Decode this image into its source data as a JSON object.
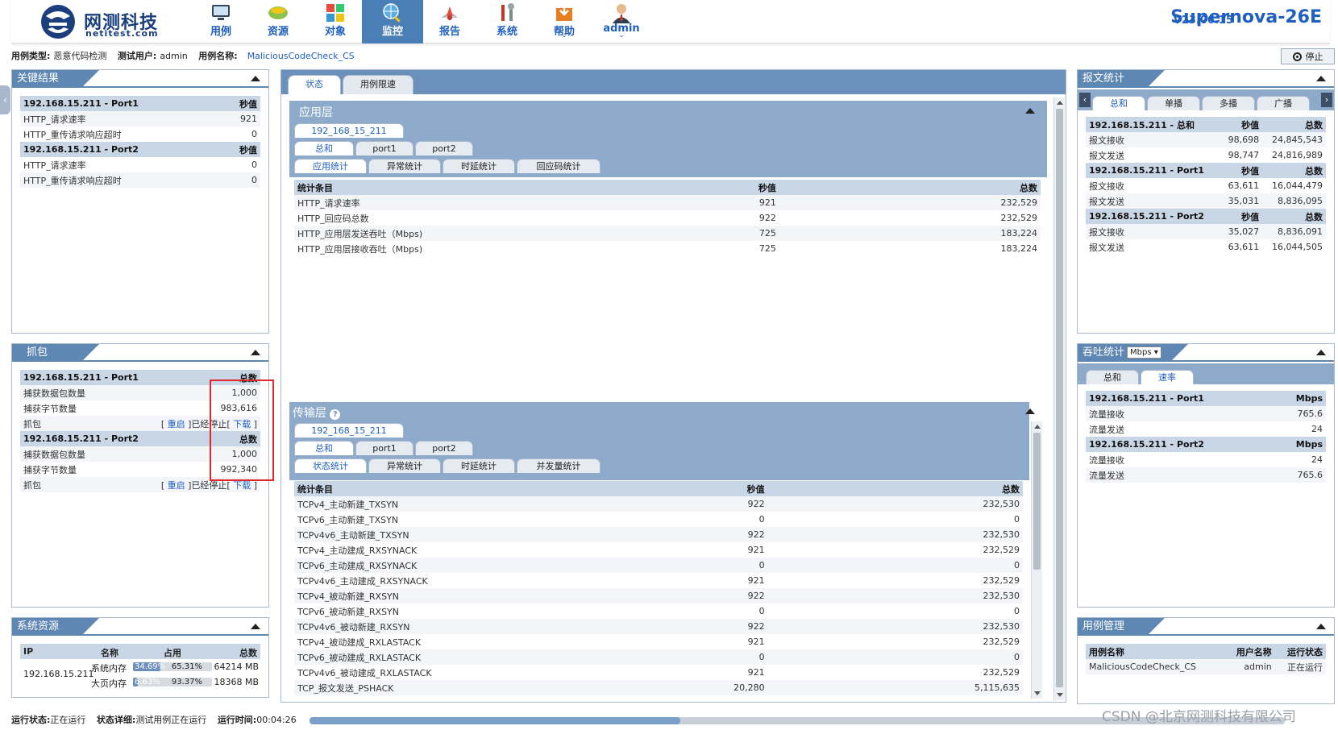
{
  "header": {
    "logo_cn": "网测科技",
    "logo_en": "netitest.com",
    "version": "V23.06.15",
    "product": "Supernova-26E",
    "nav": [
      {
        "label": "用例",
        "chevron": "⌄"
      },
      {
        "label": "资源",
        "chevron": ""
      },
      {
        "label": "对象",
        "chevron": ""
      },
      {
        "label": "监控",
        "chevron": ""
      },
      {
        "label": "报告",
        "chevron": ""
      },
      {
        "label": "系统",
        "chevron": ""
      },
      {
        "label": "帮助",
        "chevron": "⌄"
      },
      {
        "label": "admin",
        "chevron": "⌄"
      }
    ]
  },
  "info": {
    "type_k": "用例类型:",
    "type_v": "恶意代码检测",
    "user_k": "测试用户:",
    "user_v": "admin",
    "name_k": "用例名称:",
    "name_v": "MaliciousCodeCheck_CS",
    "stop": "停止"
  },
  "key_results": {
    "title": "关键结果",
    "rows": [
      {
        "h": true,
        "a": "192.168.15.211 - Port1",
        "b": "秒值"
      },
      {
        "a": "HTTP_请求速率",
        "b": "921"
      },
      {
        "a": "HTTP_重传请求响应超时",
        "b": "0",
        "help": true
      },
      {
        "h": true,
        "a": "192.168.15.211 - Port2",
        "b": "秒值"
      },
      {
        "a": "HTTP_请求速率",
        "b": "0"
      },
      {
        "a": "HTTP_重传请求响应超时",
        "b": "0",
        "help": true
      }
    ]
  },
  "capture": {
    "title": "抓包",
    "rows": [
      {
        "h": true,
        "a": "192.168.15.211 - Port1",
        "b": "总数"
      },
      {
        "a": "捕获数据包数量",
        "b": "1,000"
      },
      {
        "a": "捕获字节数量",
        "b": "983,616"
      },
      {
        "a": "抓包",
        "ctl": true
      },
      {
        "h": true,
        "a": "192.168.15.211 - Port2",
        "b": "总数"
      },
      {
        "a": "捕获数据包数量",
        "b": "1,000"
      },
      {
        "a": "捕获字节数量",
        "b": "992,340"
      },
      {
        "a": "抓包",
        "ctl": true
      }
    ],
    "restart": "重启",
    "stopped": "已经停止",
    "download": "下载"
  },
  "sysres": {
    "title": "系统资源",
    "cols": [
      "IP",
      "名称",
      "占用",
      "总数"
    ],
    "ip": "192.168.15.211",
    "mem": [
      {
        "name": "系统内存",
        "bar1": "34.69%",
        "p1": 0.3469,
        "bar2": "65.31%",
        "total": "64214 MB"
      },
      {
        "name": "大页内存",
        "bar1": "6.63%",
        "p1": 0.0663,
        "bar2": "93.37%",
        "total": "18368 MB"
      }
    ]
  },
  "center": {
    "tabs": [
      "状态",
      "用例限速"
    ],
    "app": {
      "title": "应用层",
      "ip_tab": "192_168_15_211",
      "port_tabs": [
        "总和",
        "port1",
        "port2"
      ],
      "stat_tabs": [
        "应用统计",
        "异常统计",
        "时延统计",
        "回应码统计"
      ],
      "cols": [
        "统计条目",
        "秒值",
        "总数"
      ],
      "rows": [
        [
          "HTTP_请求速率",
          "921",
          "232,529"
        ],
        [
          "HTTP_回应码总数",
          "922",
          "232,529"
        ],
        [
          "HTTP_应用层发送吞吐（Mbps)",
          "725",
          "183,224"
        ],
        [
          "HTTP_应用层接收吞吐（Mbps)",
          "725",
          "183,224"
        ]
      ]
    },
    "transport": {
      "title": "传输层",
      "ip_tab": "192_168_15_211",
      "port_tabs": [
        "总和",
        "port1",
        "port2"
      ],
      "stat_tabs": [
        "状态统计",
        "异常统计",
        "时延统计",
        "并发量统计"
      ],
      "cols": [
        "统计条目",
        "秒值",
        "总数"
      ],
      "rows": [
        [
          "TCPv4_主动新建_TXSYN",
          "922",
          "232,530"
        ],
        [
          "TCPv6_主动新建_TXSYN",
          "0",
          "0"
        ],
        [
          "TCPv4v6_主动新建_TXSYN",
          "922",
          "232,530"
        ],
        [
          "TCPv4_主动建成_RXSYNACK",
          "921",
          "232,529"
        ],
        [
          "TCPv6_主动建成_RXSYNACK",
          "0",
          "0"
        ],
        [
          "TCPv4v6_主动建成_RXSYNACK",
          "921",
          "232,529"
        ],
        [
          "TCPv4_被动新建_RXSYN",
          "922",
          "232,530"
        ],
        [
          "TCPv6_被动新建_RXSYN",
          "0",
          "0"
        ],
        [
          "TCPv4v6_被动新建_RXSYN",
          "922",
          "232,530"
        ],
        [
          "TCPv4_被动建成_RXLASTACK",
          "921",
          "232,529"
        ],
        [
          "TCPv6_被动建成_RXLASTACK",
          "0",
          "0"
        ],
        [
          "TCPv4v6_被动建成_RXLASTACK",
          "921",
          "232,529"
        ],
        [
          "TCP_报文发送_PSHACK",
          "20,280",
          "5,115,635"
        ]
      ]
    }
  },
  "packet_stats": {
    "title": "报文统计",
    "tabs": [
      "总和",
      "单播",
      "多播",
      "广播"
    ],
    "rows": [
      {
        "h": true,
        "a": "192.168.15.211 - 总和",
        "b": "秒值",
        "c": "总数"
      },
      {
        "a": "报文接收",
        "b": "98,698",
        "c": "24,845,543"
      },
      {
        "a": "报文发送",
        "b": "98,747",
        "c": "24,816,989"
      },
      {
        "h": true,
        "a": "192.168.15.211 - Port1",
        "b": "秒值",
        "c": "总数"
      },
      {
        "a": "报文接收",
        "b": "63,611",
        "c": "16,044,479"
      },
      {
        "a": "报文发送",
        "b": "35,031",
        "c": "8,836,095"
      },
      {
        "h": true,
        "a": "192.168.15.211 - Port2",
        "b": "秒值",
        "c": "总数"
      },
      {
        "a": "报文接收",
        "b": "35,027",
        "c": "8,836,091"
      },
      {
        "a": "报文发送",
        "b": "63,611",
        "c": "16,044,505"
      }
    ]
  },
  "throughput": {
    "title": "吞吐统计",
    "unit": "Mbps",
    "tabs": [
      "总和",
      "速率"
    ],
    "rows": [
      {
        "h": true,
        "a": "192.168.15.211 - Port1",
        "b": "Mbps"
      },
      {
        "a": "流量接收",
        "b": "765.6"
      },
      {
        "a": "流量发送",
        "b": "24"
      },
      {
        "h": true,
        "a": "192.168.15.211 - Port2",
        "b": "Mbps"
      },
      {
        "a": "流量接收",
        "b": "24"
      },
      {
        "a": "流量发送",
        "b": "765.6"
      }
    ]
  },
  "case_mgmt": {
    "title": "用例管理",
    "cols": [
      "用例名称",
      "用户名称",
      "运行状态"
    ],
    "row": [
      "MaliciousCodeCheck_CS",
      "admin",
      "正在运行"
    ]
  },
  "status": {
    "run_k": "运行状态:",
    "run_v": "正在运行",
    "detail_k": "状态详细:",
    "detail_v": "测试用例正在运行",
    "time_k": "运行时间:",
    "time_v": "00:04:26"
  },
  "watermark": "CSDN @北京网测科技有限公司",
  "progress": 0.38
}
